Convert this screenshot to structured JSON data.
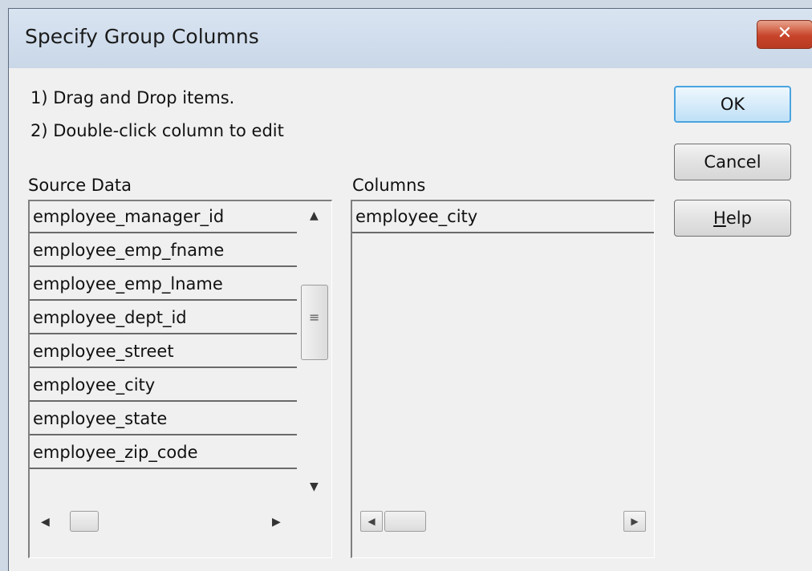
{
  "dialog": {
    "title": "Specify Group Columns",
    "close_glyph": "✕",
    "instructions": [
      "1) Drag and Drop items.",
      "2) Double-click column to edit"
    ]
  },
  "buttons": {
    "ok": "OK",
    "cancel": "Cancel",
    "help_mnemonic": "H",
    "help_rest": "elp"
  },
  "source": {
    "label": "Source Data",
    "items": [
      "employee_manager_id",
      "employee_emp_fname",
      "employee_emp_lname",
      "employee_dept_id",
      "employee_street",
      "employee_city",
      "employee_state",
      "employee_zip_code"
    ]
  },
  "columns": {
    "label": "Columns",
    "items": [
      "employee_city"
    ]
  },
  "icons": {
    "scroll_up": "up-arrow-icon",
    "scroll_down": "down-arrow-icon",
    "scroll_left": "left-arrow-icon",
    "scroll_right": "right-arrow-icon",
    "close": "close-icon",
    "grip": "grip-icon"
  },
  "colors": {
    "title_bar": "#d0dcea",
    "close_button": "#c7442a",
    "ok_border": "#4aa4e0",
    "dialog_bg": "#f0f0f0"
  }
}
